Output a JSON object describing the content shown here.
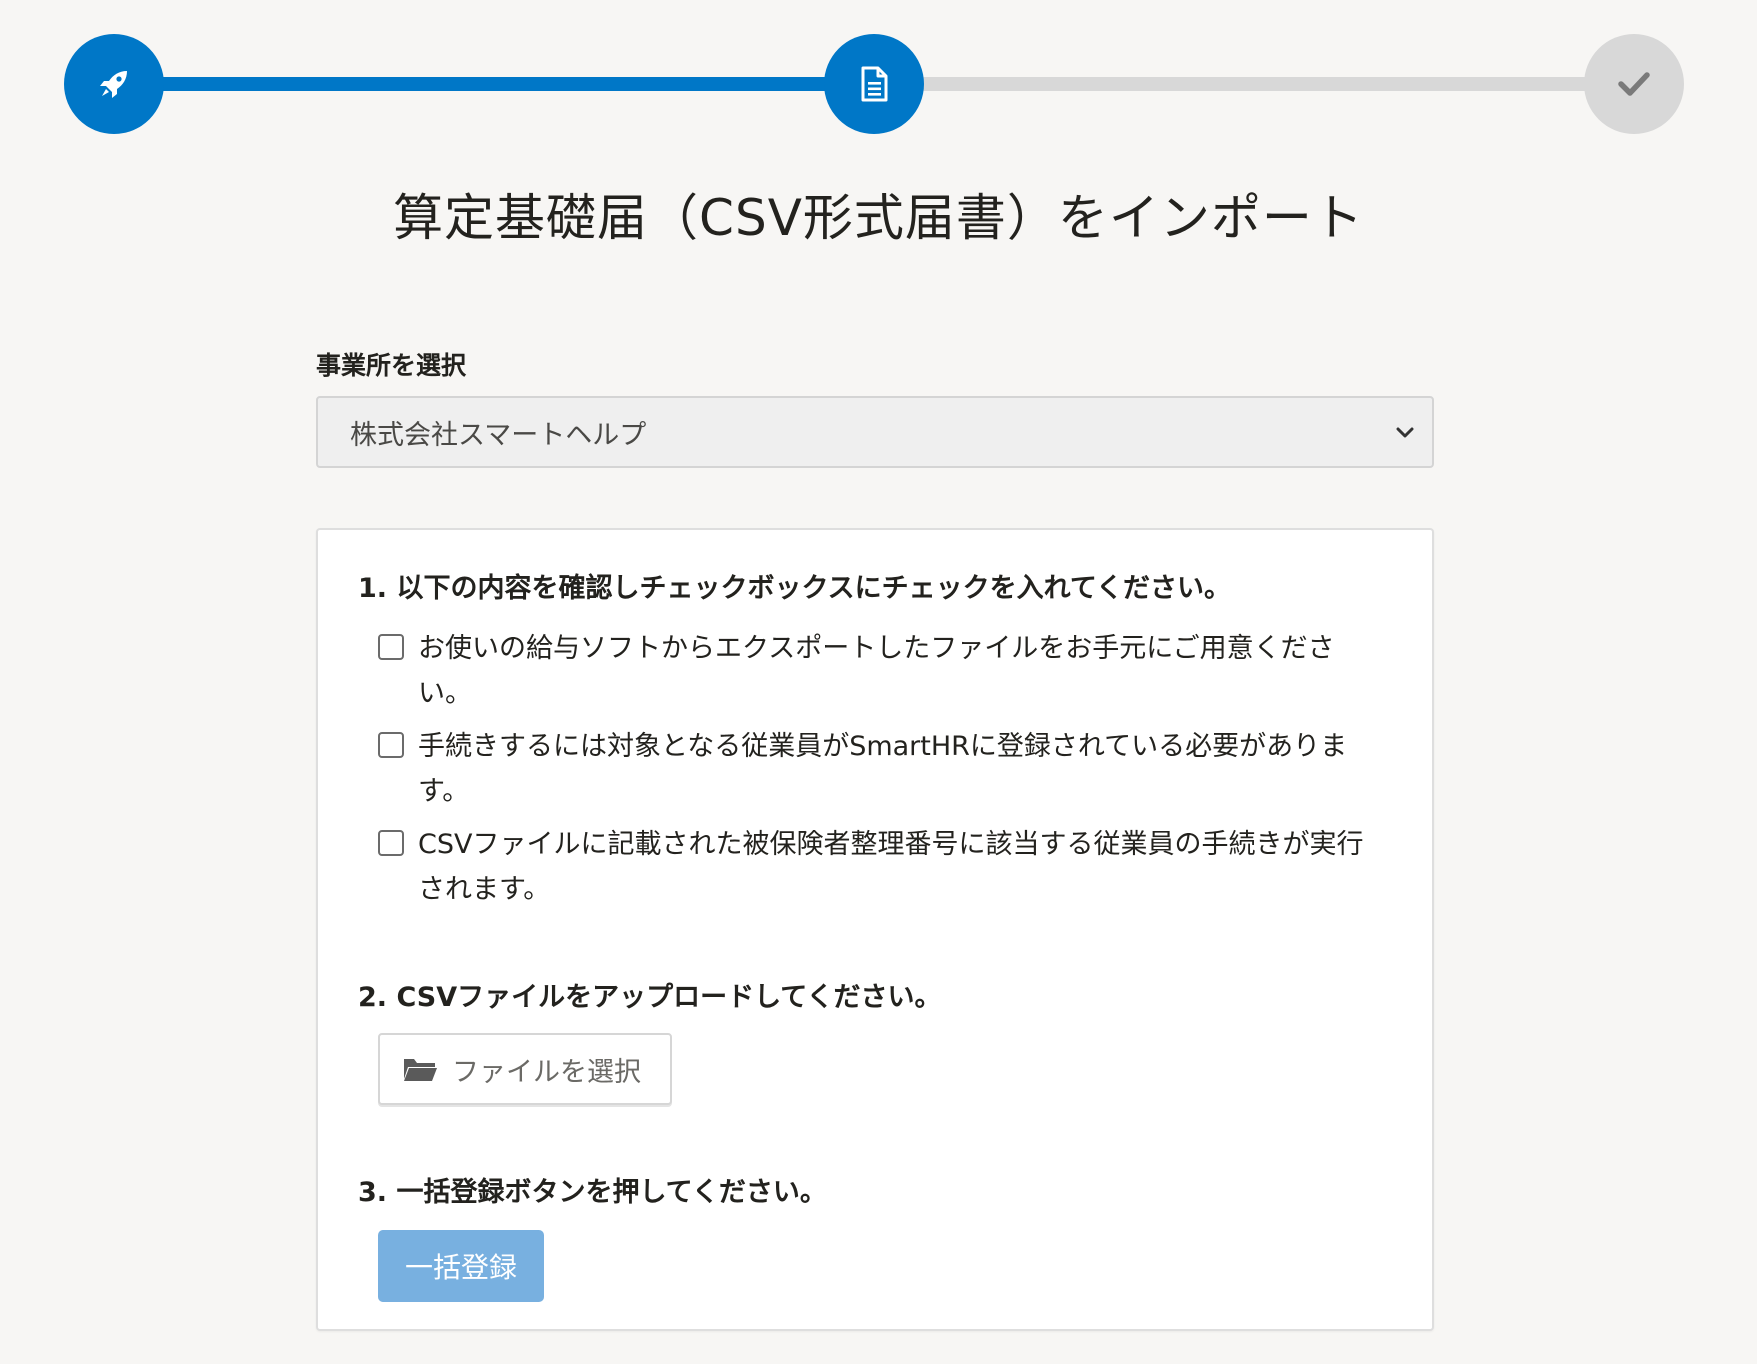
{
  "stepper": {
    "steps": [
      {
        "icon": "rocket-icon",
        "state": "active"
      },
      {
        "icon": "document-icon",
        "state": "active"
      },
      {
        "icon": "check-icon",
        "state": "inactive"
      }
    ],
    "colors": {
      "active": "#0077c7",
      "inactive": "#d8d8d8"
    }
  },
  "page": {
    "title": "算定基礎届（CSV形式届書）をインポート"
  },
  "office": {
    "label": "事業所を選択",
    "selected": "株式会社スマートヘルプ"
  },
  "steps": {
    "step1": {
      "heading": "1. 以下の内容を確認しチェックボックスにチェックを入れてください。",
      "items": [
        {
          "text": "お使いの給与ソフトからエクスポートしたファイルをお手元にご用意ください。",
          "checked": false
        },
        {
          "text": "手続きするには対象となる従業員がSmartHRに登録されている必要があります。",
          "checked": false
        },
        {
          "text": "CSVファイルに記載された被保険者整理番号に該当する従業員の手続きが実行されます。",
          "checked": false
        }
      ]
    },
    "step2": {
      "heading": "2. CSVファイルをアップロードしてください。",
      "file_button": "ファイルを選択"
    },
    "step3": {
      "heading": "3. 一括登録ボタンを押してください。",
      "submit_button": "一括登録"
    }
  },
  "colors": {
    "accent": "#0077c7",
    "submit_disabled": "#78b0e0",
    "background": "#f7f6f4"
  }
}
